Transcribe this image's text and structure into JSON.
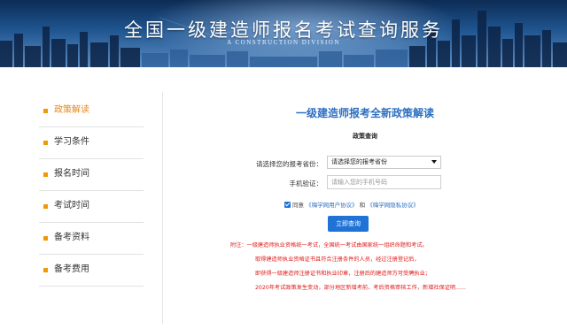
{
  "banner": {
    "title": "全国一级建造师报名考试查询服务",
    "subtitle": "A CONSTRUCTION DIVISION"
  },
  "sidebar": {
    "items": [
      {
        "label": "政策解读",
        "active": true
      },
      {
        "label": "学习条件",
        "active": false
      },
      {
        "label": "报名时间",
        "active": false
      },
      {
        "label": "考试时间",
        "active": false
      },
      {
        "label": "备考资料",
        "active": false
      },
      {
        "label": "备考费用",
        "active": false
      }
    ]
  },
  "content": {
    "title": "一级建造师报考全新政策解读",
    "section_label": "政策查询",
    "province_label": "请选择您的报考省份：",
    "province_value": "请选择您的报考省份",
    "phone_label": "手机验证：",
    "phone_placeholder": "请输入您的手机号码",
    "agree_text": "同意",
    "agree_link1": "《嗨学网用户协议》",
    "agree_and": "和",
    "agree_link2": "《嗨学网隐私协议》",
    "submit_label": "立即查询",
    "notes": [
      "附注：一级建造师执业资格统一考试，全国统一考试由国家统一组织命题和考试。",
      "取得建造师执业资格证书且符合注册条件的人员，经过注册登记后，",
      "即获得一级建造师注册证书和执业印章，注册后的建造师方可受聘执业；",
      "2020年考试政策发生变动，部分地区新增考前、考后资格审核工作，新增社保证明......"
    ]
  },
  "colors": {
    "accent_blue": "#1f72d6",
    "title_blue": "#2b6fc2",
    "bullet_orange": "#f39800",
    "note_red": "#e11a1a"
  }
}
